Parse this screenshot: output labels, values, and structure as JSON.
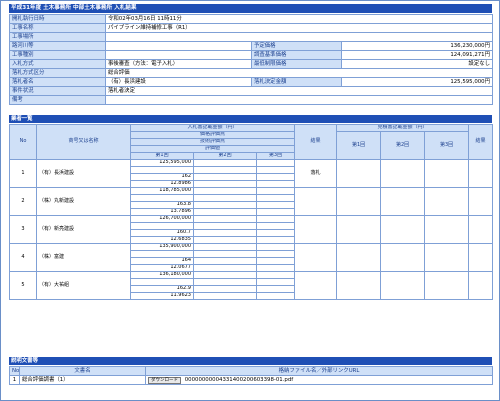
{
  "page_title": "平成31年度 土木事務所 中部土木事務所 入札結果",
  "info": {
    "date_label": "開札執行日時",
    "date_value": "令和02年03月16日 11時11分",
    "work_name_label": "工事名称",
    "work_name_value": "パイプライン維持補修工事（R1）",
    "place_label": "工事場所",
    "place_value": "",
    "river_label": "路河川等",
    "river_value": "",
    "type_label": "工事種別",
    "type_value": "",
    "method_label": "入札方式",
    "method_value": "事後審査（方法：電子入札）",
    "winner_method_label": "落札方式区分",
    "winner_method_value": "総合評価",
    "winner_label": "落札者名",
    "winner_value": "（有）長浜建設",
    "status_label": "事件状況",
    "status_value": "落札者決定",
    "remarks_label": "備考",
    "remarks_value": "",
    "planned_price_label": "予定価格",
    "planned_price_value": "136,230,000円",
    "survey_label": "調査基準価格",
    "survey_value": "124,091,271円",
    "min_label": "最低制限価格",
    "min_value": "設定なし",
    "decided_label": "落札決定金額",
    "decided_value": "125,595,000円"
  },
  "bidders_section": "業者一覧",
  "headers": {
    "no": "No",
    "name": "商号又は名称",
    "bid_amount": "入札書記載金額（円）",
    "score1": "価格評価点",
    "score2": "技術評価点",
    "score3": "評価値",
    "result": "結果",
    "confirm_amount": "見積書記載金額（円）",
    "round1": "第1回",
    "round2": "第2回",
    "round3": "第3回"
  },
  "bidders": [
    {
      "no": "1",
      "name": "（有）長浜建設",
      "amount": "125,595,000",
      "price_score": "",
      "tech_score": "162",
      "eval": "12.8986",
      "result": "落札"
    },
    {
      "no": "2",
      "name": "（株）丸新建設",
      "amount": "118,785,000",
      "price_score": "",
      "tech_score": "163.8",
      "eval": "13.7896",
      "result": ""
    },
    {
      "no": "3",
      "name": "（有）新亮建設",
      "amount": "126,700,000",
      "price_score": "",
      "tech_score": "160.7",
      "eval": "12.6835",
      "result": ""
    },
    {
      "no": "4",
      "name": "（株）富建",
      "amount": "135,900,000",
      "price_score": "",
      "tech_score": "164",
      "eval": "12.0677",
      "result": ""
    },
    {
      "no": "5",
      "name": "（有）大祐組",
      "amount": "136,180,000",
      "price_score": "",
      "tech_score": "162.9",
      "eval": "11.9623",
      "result": ""
    }
  ],
  "docs_section": "説明文書等",
  "docs_headers": {
    "no": "No",
    "name": "文書名",
    "file": "格納ファイル名／外部リンクURL"
  },
  "docs": [
    {
      "no": "1",
      "name": "総合評価調書（1）",
      "button": "ダウンロード",
      "file": "00000000004331400200603398-01.pdf"
    }
  ]
}
